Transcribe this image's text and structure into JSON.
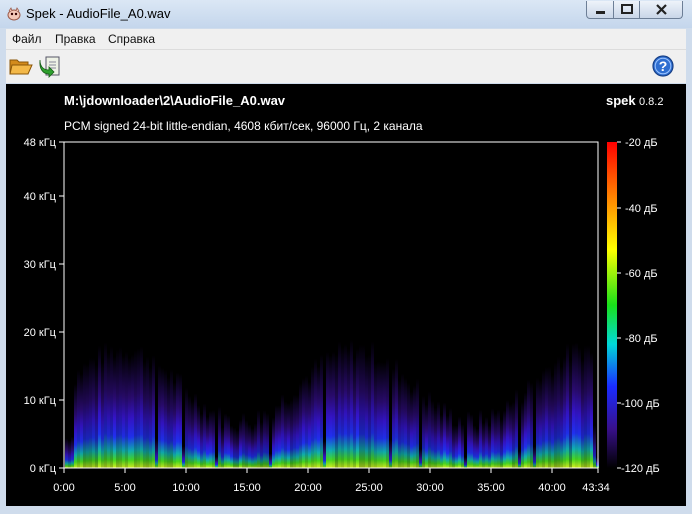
{
  "window": {
    "title": "Spek - AudioFile_A0.wav"
  },
  "menu": {
    "items": [
      "Файл",
      "Правка",
      "Справка"
    ]
  },
  "toolbar": {
    "open_icon": "folder-open-icon",
    "save_icon": "save-image-icon",
    "help_icon": "help-icon"
  },
  "spectrum": {
    "file_path": "M:\\jdownloader\\2\\AudioFile_A0.wav",
    "format_info": "PCM signed 24-bit little-endian, 4608 кбит/сек, 96000 Гц, 2 канала",
    "app_name": "spek",
    "app_version": "0.8.2",
    "freq_labels": [
      "48 кГц",
      "40 кГц",
      "30 кГц",
      "20 кГц",
      "10 кГц",
      "0 кГц"
    ],
    "time_labels": [
      "0:00",
      "5:00",
      "10:00",
      "15:00",
      "20:00",
      "25:00",
      "30:00",
      "35:00",
      "40:00",
      "43:34"
    ],
    "db_labels": [
      "-20 дБ",
      "-40 дБ",
      "-60 дБ",
      "-80 дБ",
      "-100 дБ",
      "-120 дБ"
    ]
  },
  "colors": {
    "background": "#000000",
    "scale_top": "#ff0000",
    "scale_bottom": "#000000"
  }
}
